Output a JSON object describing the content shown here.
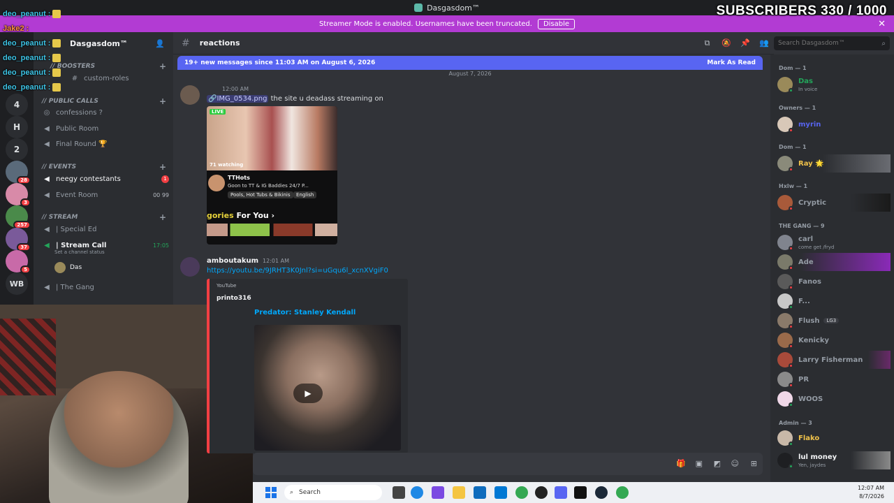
{
  "window": {
    "title": "Dasgasdom™"
  },
  "overlay": {
    "subscribers": "SUBSCRIBERS 330 / 1000",
    "chat": [
      {
        "user": "deo_peanut :",
        "color": "cyan"
      },
      {
        "user": "Jake2 :",
        "color": "orange"
      },
      {
        "user": "deo_peanut :",
        "color": "cyan"
      },
      {
        "user": "deo_peanut :",
        "color": "cyan"
      },
      {
        "user": "deo_peanut :",
        "color": "cyan"
      },
      {
        "user": "deo_peanut :",
        "color": "cyan"
      }
    ]
  },
  "banner": {
    "text": "Streamer Mode is enabled. Usernames have been truncated.",
    "disable_label": "Disable",
    "close": "✕"
  },
  "rail": {
    "items": [
      {
        "label": "4"
      },
      {
        "label": "H"
      },
      {
        "label": "2"
      },
      {
        "label": "",
        "badge": "28"
      },
      {
        "label": "",
        "badge": "3"
      },
      {
        "label": "",
        "badge": "257"
      },
      {
        "label": "",
        "badge": "37"
      },
      {
        "label": "",
        "badge": "5"
      },
      {
        "label": "WB"
      }
    ]
  },
  "server": {
    "name": "Dasgasdom™"
  },
  "channels": {
    "categories": {
      "boosters": "// Boosters",
      "public_calls": "// PUBLIC CALLS",
      "events": "// Events",
      "stream": "// STREAM"
    },
    "custom_roles": "custom-roles",
    "confessions": "confessions ?",
    "public_room": "Public Room",
    "final_round": "Final Round 🏆",
    "neegy": "neegy contestants",
    "neegy_badge": "1",
    "event_room": "Event Room",
    "event_room_counts": "00  99",
    "special_ed": "| Special Ed",
    "stream_call": "| Stream Call",
    "stream_call_time": "17:05",
    "set_status": "Set a channel status",
    "voice_user": "Das",
    "the_gang": "| The Gang"
  },
  "chat_header": {
    "channel": "reactions"
  },
  "search": {
    "placeholder": "Search Dasgasdom™"
  },
  "new_messages": {
    "text": "19+ new messages since 11:03 AM on August 6, 2026",
    "mark_read": "Mark As Read"
  },
  "date_divider": "August 7, 2026",
  "messages": [
    {
      "author": "",
      "time": "12:00 AM",
      "attachment": "IMG_0534.png",
      "text": "the site u deadass streaming on",
      "screenshot": {
        "live": "LIVE",
        "watching": "71 watching",
        "name": "TTHots",
        "desc": "Goon to TT & IG Baddies 24/7 P...",
        "tag1": "Pools, Hot Tubs & Bikinis",
        "tag2": "English",
        "cats_prefix": "gories",
        "cats_suffix": "For You ›"
      }
    },
    {
      "author": "amboutakum",
      "time": "12:01 AM",
      "link": "https://youtu.be/9JRHT3K0Jnl?si=uGqu6l_xcnXVgiF0",
      "embed": {
        "provider": "YouTube",
        "channel": "printo316",
        "title": "Predator: Stanley Kendall"
      }
    }
  ],
  "members": {
    "groups": [
      {
        "label": "Dom — 1",
        "members": [
          {
            "name": "Das",
            "sub": "In voice",
            "color": "#23a55a"
          }
        ]
      },
      {
        "label": "Owners — 1",
        "members": [
          {
            "name": "myrin",
            "color": "#5865f2"
          }
        ]
      },
      {
        "label": "Dom — 1",
        "members": [
          {
            "name": "Ray 🌟",
            "color": "#f0c24a"
          }
        ]
      },
      {
        "label": "Hxlw — 1",
        "members": [
          {
            "name": "Cryptic",
            "color": "#949ba4"
          }
        ]
      },
      {
        "label": "THE GANG — 9",
        "members": [
          {
            "name": "carl",
            "sub": "come get /fryd",
            "color": "#949ba4"
          },
          {
            "name": "Ade",
            "color": "#949ba4"
          },
          {
            "name": "Fanos",
            "color": "#949ba4"
          },
          {
            "name": "F...",
            "color": "#949ba4"
          },
          {
            "name": "Flush",
            "tag": "LG3",
            "color": "#949ba4"
          },
          {
            "name": "Kenicky",
            "color": "#949ba4"
          },
          {
            "name": "Larry Fisherman",
            "color": "#949ba4"
          },
          {
            "name": "PR",
            "color": "#949ba4"
          },
          {
            "name": "WOOS",
            "color": "#949ba4"
          }
        ]
      },
      {
        "label": "Admin — 3",
        "members": [
          {
            "name": "Flako",
            "color": "#f0c24a"
          },
          {
            "name": "lul money",
            "sub": "Yen, jaydes",
            "color": "#f2f3f5"
          }
        ]
      }
    ]
  },
  "taskbar": {
    "search_placeholder": "Search",
    "time": "12:07 AM",
    "date": "8/7/2026"
  },
  "colors": {
    "accent": "#5865f2",
    "banner": "#b23bd3",
    "online": "#23a55a",
    "dnd": "#f23f43"
  }
}
